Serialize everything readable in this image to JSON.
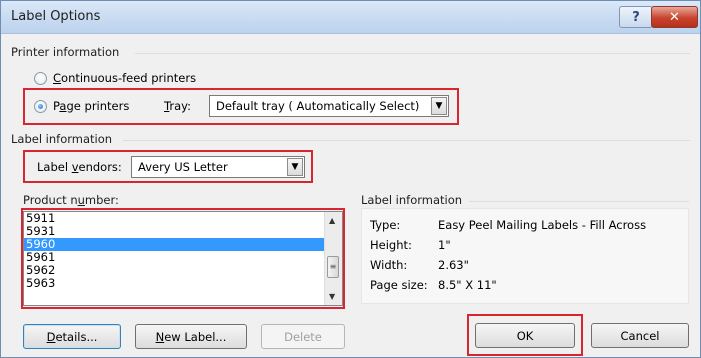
{
  "window": {
    "title": "Label Options",
    "help_symbol": "?",
    "close_symbol": "✕"
  },
  "printer_info": {
    "group_label": "Printer information",
    "continuous_feed_label": "Continuous-feed printers",
    "page_printers_label": "Page printers",
    "selected": "page_printers",
    "tray_label": "Tray:",
    "tray_value": "Default tray ( Automatically Select)"
  },
  "label_info": {
    "group_label": "Label information",
    "vendors_label": "Label vendors:",
    "vendors_value": "Avery US Letter"
  },
  "product": {
    "label": "Product number:",
    "items": [
      "5911",
      "5931",
      "5960",
      "5961",
      "5962",
      "5963"
    ],
    "selected": "5960"
  },
  "details": {
    "group_label": "Label information",
    "type_key": "Type:",
    "type_value": "Easy Peel Mailing Labels - Fill Across",
    "height_key": "Height:",
    "height_value": "1\"",
    "width_key": "Width:",
    "width_value": "2.63\"",
    "page_size_key": "Page size:",
    "page_size_value": "8.5\" X 11\""
  },
  "buttons": {
    "details": "Details...",
    "new_label": "New Label...",
    "delete": "Delete",
    "ok": "OK",
    "cancel": "Cancel"
  },
  "colors": {
    "highlight_box": "#d8262f",
    "selection": "#3399ff"
  }
}
